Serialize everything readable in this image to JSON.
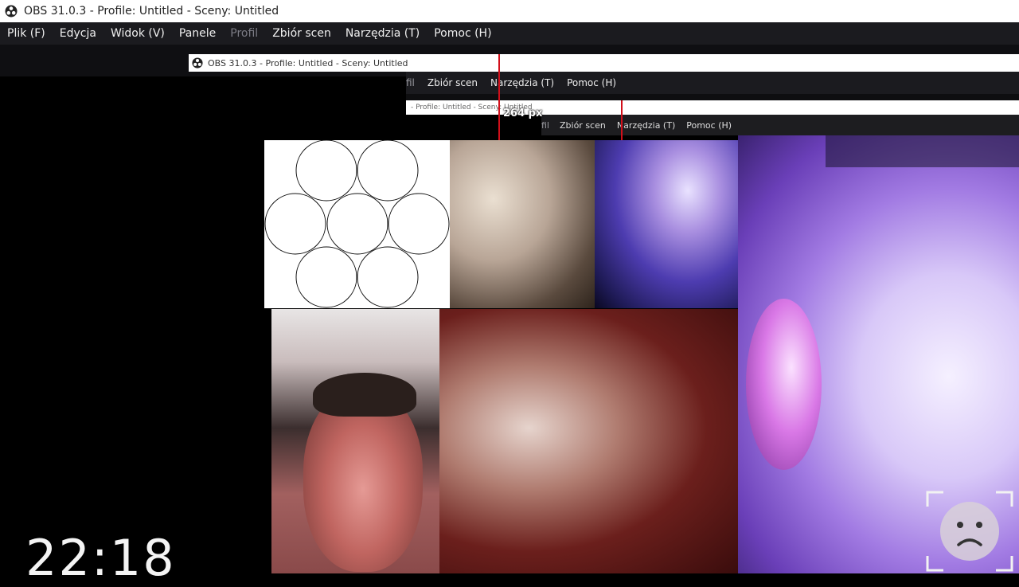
{
  "main_window": {
    "title": "OBS 31.0.3 - Profile: Untitled - Sceny: Untitled",
    "menu": [
      "Plik (F)",
      "Edycja",
      "Widok (V)",
      "Panele",
      "Profil",
      "Zbiór scen",
      "Narzędzia (T)",
      "Pomoc (H)"
    ],
    "disabled_menu": "Profil"
  },
  "nested_window_1": {
    "title": "OBS 31.0.3 - Profile: Untitled - Sceny: Untitled",
    "menu_cut": "fil",
    "menu": [
      "Zbiór scen",
      "Narzędzia (T)",
      "Pomoc (H)"
    ]
  },
  "nested_window_2": {
    "title": "- Profile: Untitled - Sceny: Untitled",
    "menu_cut": "fil",
    "menu": [
      "Zbiór scen",
      "Narzędzia (T)",
      "Pomoc (H)"
    ]
  },
  "measure": {
    "label": "264 px",
    "color": "#d20f1a"
  },
  "clock": {
    "text": "22:18"
  },
  "colors": {
    "menubar_bg": "#1b1b1f",
    "titlebar_bg": "#ffffff",
    "canvas_bg": "#000000"
  },
  "icons": {
    "app_logo": "obs-logo-icon",
    "button": "sad-face-icon"
  }
}
